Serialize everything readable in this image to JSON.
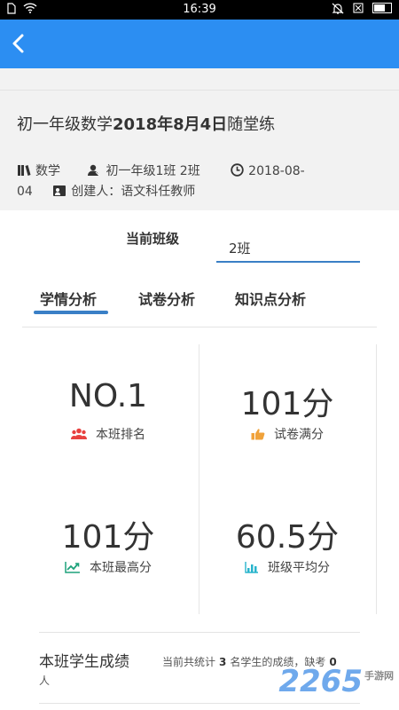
{
  "status_bar": {
    "time": "16:39"
  },
  "assignment": {
    "title_prefix": "初一年级数学",
    "title_bold": "2018年8月4日",
    "title_suffix": "随堂练",
    "subject": "数学",
    "classes": "初一年级1班 2班",
    "date_part1": "2018-08-",
    "date_part2": "04",
    "creator": "创建人：语文科任教师"
  },
  "class_selector": {
    "label": "当前班级",
    "value": "2班"
  },
  "tabs": [
    {
      "label": "学情分析",
      "active": true
    },
    {
      "label": "试卷分析",
      "active": false
    },
    {
      "label": "知识点分析",
      "active": false
    }
  ],
  "stats": [
    {
      "value": "NO.1",
      "label": "本班排名",
      "icon": "users-icon",
      "color": "#e8413f"
    },
    {
      "value": "101分",
      "label": "试卷满分",
      "icon": "thumbs-up-icon",
      "color": "#f0a23a"
    },
    {
      "value": "101分",
      "label": "本班最高分",
      "icon": "trend-up-icon",
      "color": "#1ea27b"
    },
    {
      "value": "60.5分",
      "label": "班级平均分",
      "icon": "bar-chart-icon",
      "color": "#28b4cc"
    }
  ],
  "scores_section": {
    "title": "本班学生成绩",
    "note_prefix": "当前共统计",
    "count": "3",
    "note_middle": "名学生的成绩，缺考",
    "absent": "0",
    "note_suffix": "人"
  },
  "watermark": {
    "main": "2265",
    "sub": "手游网"
  },
  "colors": {
    "primary": "#2c8ef2",
    "accent": "#3a7fc6"
  }
}
